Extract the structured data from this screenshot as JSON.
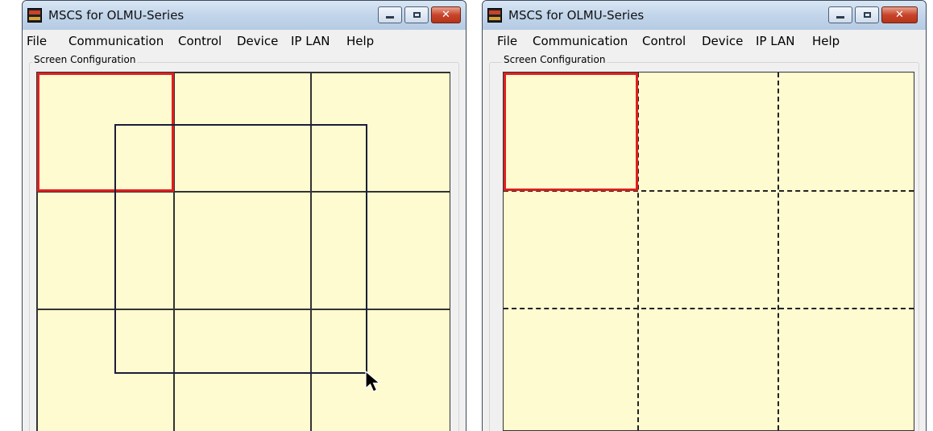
{
  "windows": [
    {
      "title": "MSCS for OLMU-Series",
      "menu": [
        "File",
        "Communication",
        "Control",
        "Device",
        "IP LAN",
        "Help"
      ],
      "group_label": "Screen Configuration"
    },
    {
      "title": "MSCS for OLMU-Series",
      "menu": [
        "File",
        "Communication",
        "Control",
        "Device",
        "IP LAN",
        "Help"
      ],
      "group_label": "Screen Configuration"
    }
  ],
  "colors": {
    "canvas": "#fffbd0",
    "selection": "#e02020",
    "titlebar": "#c4d5e8"
  },
  "icons": [
    "app-icon",
    "minimize-icon",
    "maximize-icon",
    "close-icon",
    "mouse-pointer-icon"
  ]
}
